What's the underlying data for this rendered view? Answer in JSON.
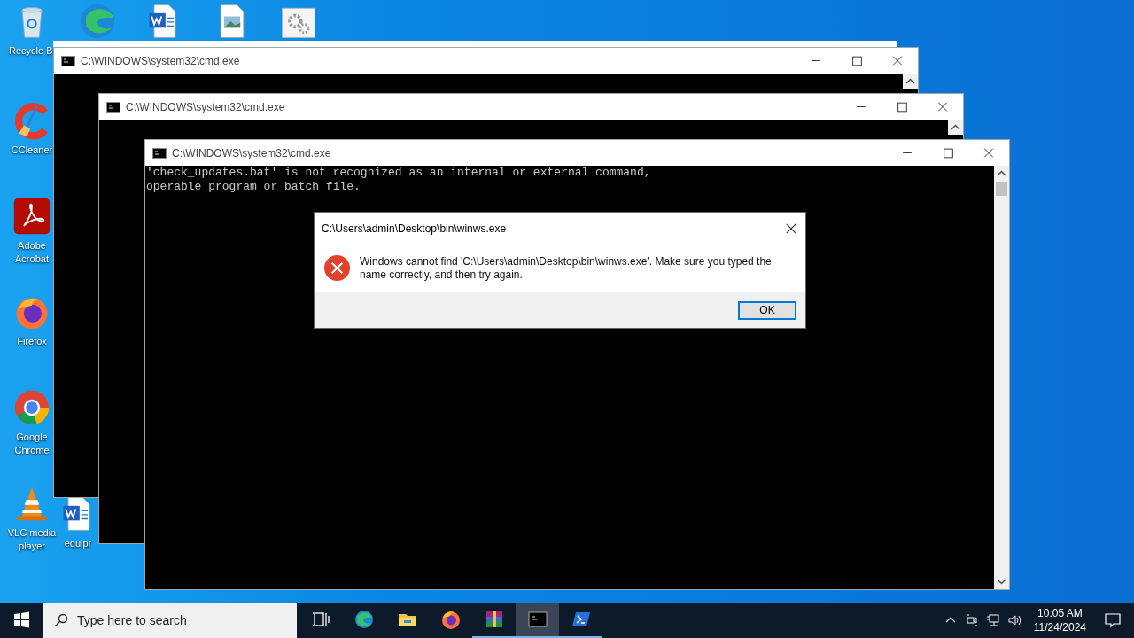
{
  "desktop_icons": [
    {
      "kind": "recycle",
      "label": "Recycle Bi"
    },
    {
      "kind": "edge"
    },
    {
      "kind": "word"
    },
    {
      "kind": "image"
    },
    {
      "kind": "gear"
    },
    {
      "kind": "ccleaner",
      "label": "CCleaner"
    },
    {
      "kind": "acrobat",
      "label": "Adobe Acrobat"
    },
    {
      "kind": "firefox",
      "label": "Firefox"
    },
    {
      "kind": "chrome",
      "label": "Google Chrome"
    },
    {
      "kind": "vlc",
      "label": "VLC media player"
    },
    {
      "kind": "word",
      "label": "equipr"
    }
  ],
  "windows": [
    {
      "title": "C:\\WINDOWS\\system32\\cmd.exe"
    },
    {
      "title": "C:\\WINDOWS\\system32\\cmd.exe"
    },
    {
      "title": "C:\\WINDOWS\\system32\\cmd.exe",
      "lines": [
        "'check_updates.bat' is not recognized as an internal or external command,",
        "operable program or batch file."
      ]
    }
  ],
  "dialog": {
    "title": "C:\\Users\\admin\\Desktop\\bin\\winws.exe",
    "message": "Windows cannot find 'C:\\Users\\admin\\Desktop\\bin\\winws.exe'. Make sure you typed the name correctly, and then try again.",
    "button": "OK"
  },
  "taskbar": {
    "search": {
      "placeholder": "Type here to search"
    },
    "apps": [
      {
        "kind": "taskview",
        "running": false,
        "selected": false
      },
      {
        "kind": "edge",
        "running": false,
        "selected": false
      },
      {
        "kind": "explorer",
        "running": false,
        "selected": false
      },
      {
        "kind": "firefox",
        "running": false,
        "selected": false
      },
      {
        "kind": "winrar",
        "running": true,
        "selected": false
      },
      {
        "kind": "cmd",
        "running": true,
        "selected": true
      },
      {
        "kind": "powershell",
        "running": true,
        "selected": false
      }
    ],
    "time": "10:05 AM",
    "date": "11/24/2024"
  }
}
